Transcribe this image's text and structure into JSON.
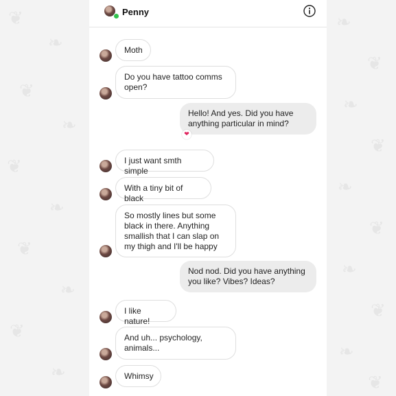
{
  "header": {
    "contact_name": "Penny",
    "status": "online",
    "info_icon": "info-icon"
  },
  "messages": [
    {
      "from": "them",
      "text": "Moth"
    },
    {
      "from": "them",
      "text": "Do you have tattoo comms open?"
    },
    {
      "from": "me",
      "text": "Hello! And yes. Did you have anything particular in mind?",
      "reaction": "❤"
    },
    {
      "from": "them",
      "text": "I just want smth simple"
    },
    {
      "from": "them",
      "text": "With a tiny bit of black"
    },
    {
      "from": "them",
      "text": "So mostly lines but some black in there. Anything smallish that I can slap on my thigh and I'll be happy"
    },
    {
      "from": "me",
      "text": "Nod nod. Did you have anything you like? Vibes? Ideas?"
    },
    {
      "from": "them",
      "text": "I like nature!"
    },
    {
      "from": "them",
      "text": "And uh... psychology, animals..."
    },
    {
      "from": "them",
      "text": "Whimsy"
    }
  ],
  "colors": {
    "background": "#f3f3f3",
    "incoming_bubble": "#ffffff",
    "outgoing_bubble": "#ececec",
    "online": "#31c24d",
    "reaction_heart": "#e0245e"
  }
}
